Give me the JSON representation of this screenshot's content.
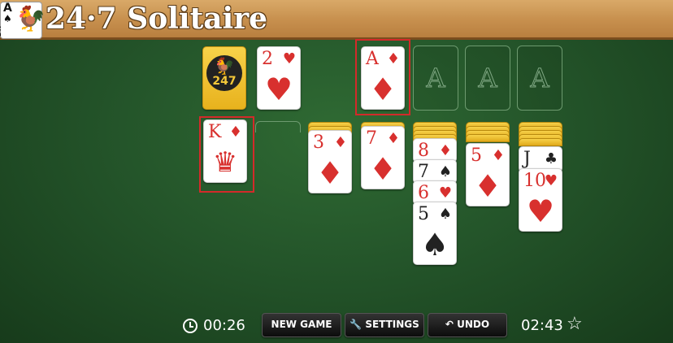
{
  "header": {
    "title": "24·7 Solitaire",
    "logo_rank": "A",
    "logo_suit": "♠",
    "logo_brand": "247"
  },
  "stock": {
    "emblem_text": "247"
  },
  "waste": {
    "rank": "2",
    "suit": "♥"
  },
  "foundations": [
    {
      "rank": "A",
      "suit": "♦"
    },
    {
      "placeholder": "A"
    },
    {
      "placeholder": "A"
    },
    {
      "placeholder": "A"
    }
  ],
  "tableau": {
    "col1": [
      {
        "rank": "K",
        "suit": "♦",
        "face": "♛"
      }
    ],
    "col3": [
      {
        "rank": "3",
        "suit": "♦"
      }
    ],
    "col4": [
      {
        "rank": "7",
        "suit": "♦"
      }
    ],
    "col5": [
      {
        "rank": "8",
        "suit": "♦"
      },
      {
        "rank": "7",
        "suit": "♠"
      },
      {
        "rank": "6",
        "suit": "♥"
      },
      {
        "rank": "5",
        "suit": "♠"
      }
    ],
    "col6": [
      {
        "rank": "5",
        "suit": "♦"
      }
    ],
    "col7": [
      {
        "rank": "J",
        "suit": "♣"
      },
      {
        "rank": "10",
        "suit": "♥"
      }
    ]
  },
  "toolbar": {
    "elapsed": "00:26",
    "new_game": "NEW GAME",
    "settings": "SETTINGS",
    "undo": "UNDO",
    "best_time": "02:43",
    "settings_icon": "wrench-icon",
    "undo_icon": "undo-arrow-icon",
    "star_icon": "star-icon",
    "clock_icon": "clock-icon"
  },
  "colors": {
    "felt": "#24552a",
    "highlight": "#d32a2a",
    "card_red": "#d8302e",
    "stock_gold": "#f0c332"
  }
}
